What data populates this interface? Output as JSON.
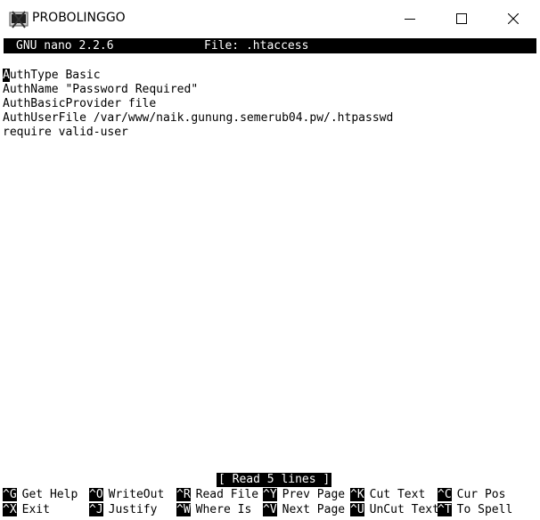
{
  "window": {
    "title": "PROBOLINGGO"
  },
  "icons": {
    "app": "putty-icon",
    "minimize": "minimize-icon",
    "maximize": "maximize-icon",
    "close": "close-icon"
  },
  "nano": {
    "version": "GNU nano 2.2.6",
    "file_label": "File: .htaccess",
    "cursor_char": "A",
    "first_line_rest": "uthType Basic",
    "lines": [
      "AuthName \"Password Required\"",
      "AuthBasicProvider file",
      "AuthUserFile /var/www/naik.gunung.semerub04.pw/.htpasswd",
      "require valid-user"
    ],
    "status": "[ Read 5 lines ]"
  },
  "shortcuts": [
    {
      "key": "^G",
      "label": "Get Help"
    },
    {
      "key": "^O",
      "label": "WriteOut"
    },
    {
      "key": "^R",
      "label": "Read File"
    },
    {
      "key": "^Y",
      "label": "Prev Page"
    },
    {
      "key": "^K",
      "label": "Cut Text"
    },
    {
      "key": "^C",
      "label": "Cur Pos"
    },
    {
      "key": "^X",
      "label": "Exit"
    },
    {
      "key": "^J",
      "label": "Justify"
    },
    {
      "key": "^W",
      "label": "Where Is"
    },
    {
      "key": "^V",
      "label": "Next Page"
    },
    {
      "key": "^U",
      "label": "UnCut Text"
    },
    {
      "key": "^T",
      "label": "To Spell"
    }
  ],
  "colors": {
    "terminal_bg": "#ffffff",
    "terminal_fg": "#000000",
    "inverse_bg": "#000000"
  }
}
